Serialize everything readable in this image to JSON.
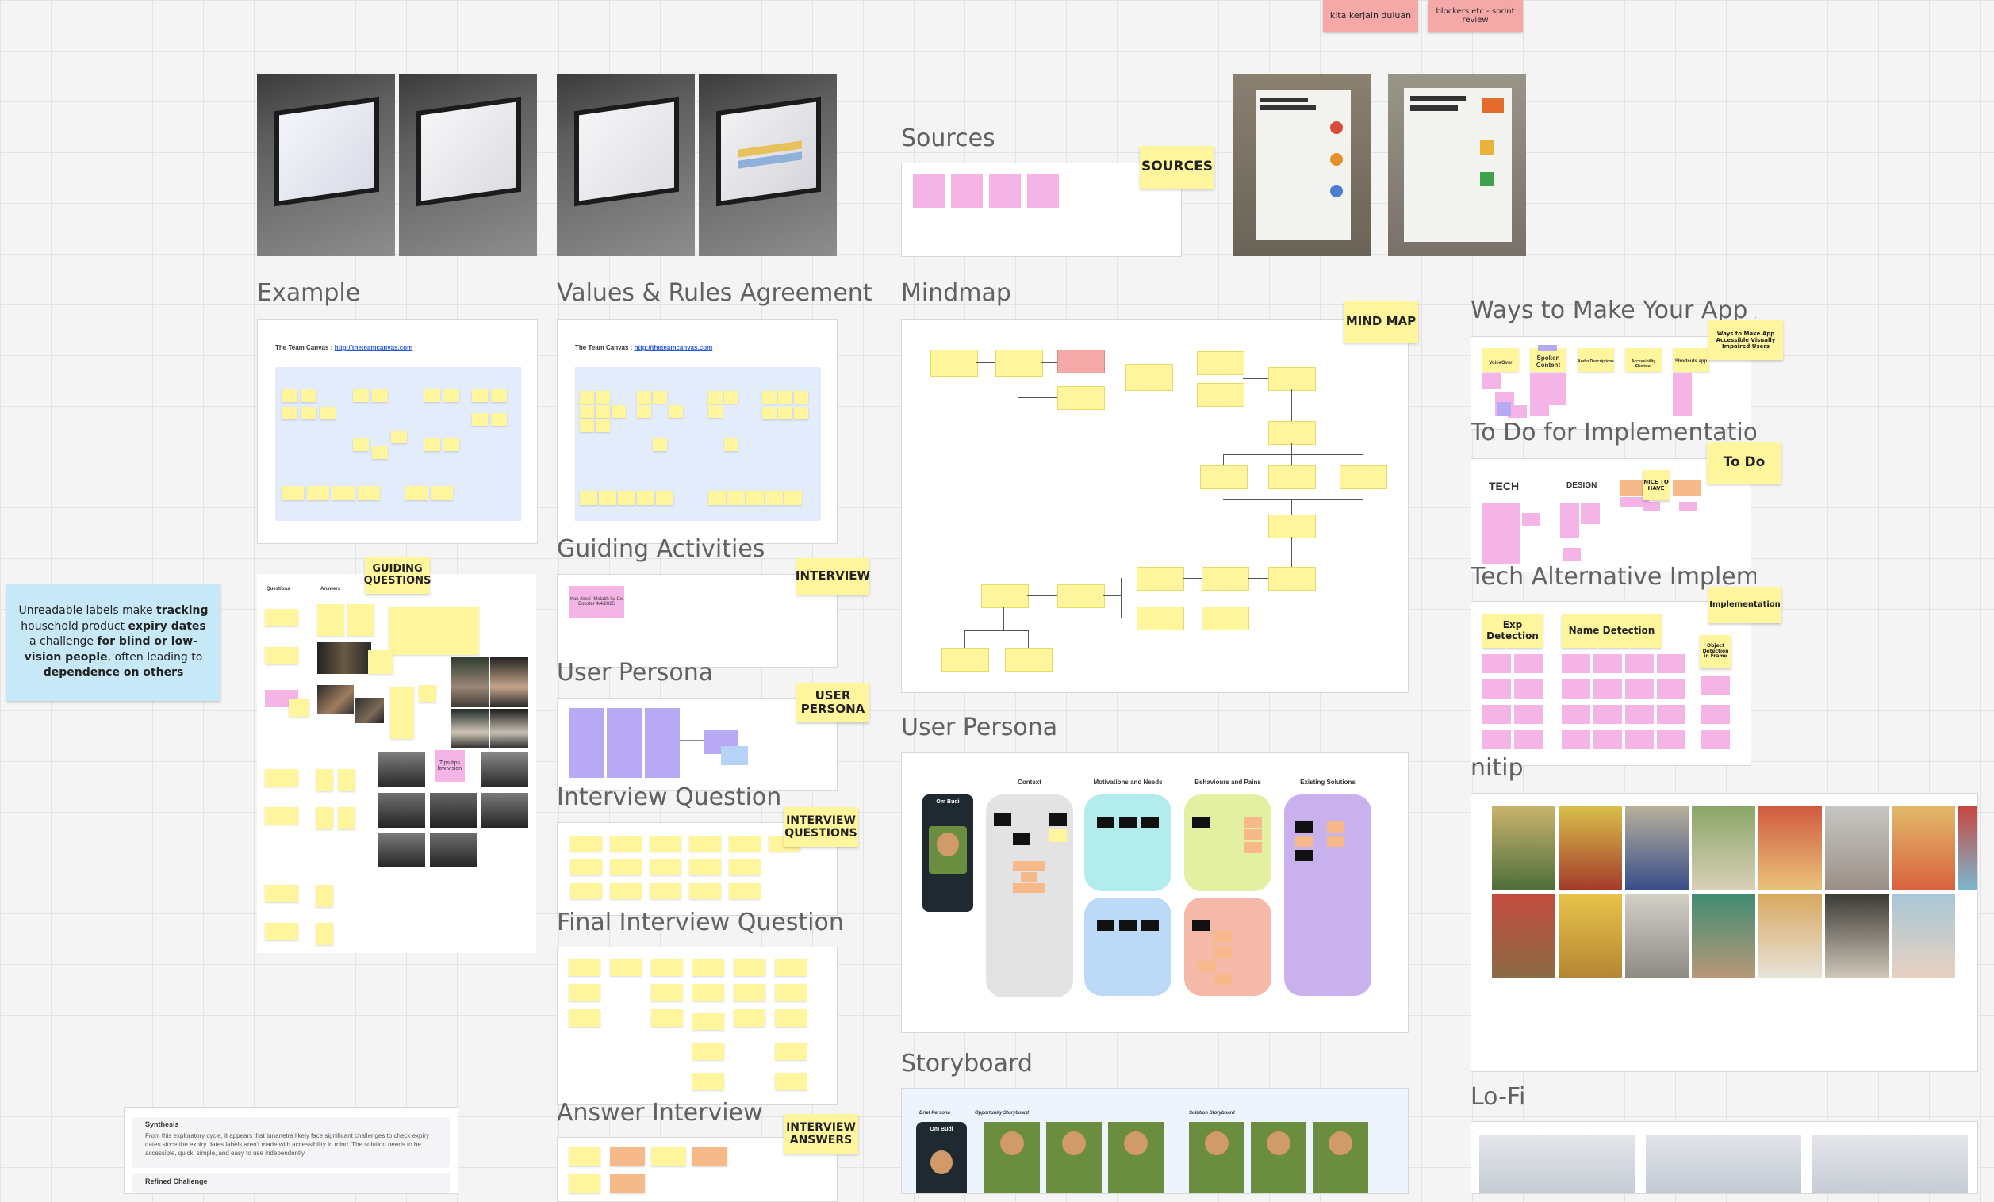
{
  "top_notes": [
    {
      "text": "kita kerjain duluan"
    },
    {
      "text": "blockers etc - sprint review"
    }
  ],
  "frames": {
    "example": "Example",
    "values": "Values & Rules Agreement",
    "guiding_activities": "Guiding Activities",
    "user_persona_small": "User Persona",
    "interview_question": "Interview Question",
    "final_interview_question": "Final Interview Question",
    "answer_interview": "Answer Interview",
    "sources": "Sources",
    "mindmap": "Mindmap",
    "user_persona": "User Persona",
    "storyboard": "Storyboard",
    "ways": "Ways to Make Your App A...",
    "todo_impl": "To Do for Implementatio...",
    "tech_alt": "Tech Alternative Impleme...",
    "nitip": "nitip",
    "lofi": "Lo-Fi"
  },
  "labels": {
    "sources": "SOURCES",
    "mind_map": "MIND MAP",
    "guiding_questions": "GUIDING QUESTIONS",
    "interview": "INTERVIEW",
    "user_persona": "USER PERSONA",
    "interview_questions": "INTERVIEW QUESTIONS",
    "interview_answers": "INTERVIEW ANSWERS",
    "to_do": "To Do",
    "implementation": "Implementation",
    "ways_note": "Ways to Make App Accessible Visually Impaired Users"
  },
  "team_canvas": {
    "title": "The Team Canvas :",
    "link": "http://theteamcanvas.com"
  },
  "problem_note": {
    "p1": "Unreadable labels make ",
    "b1": "tracking",
    "p2": " household product ",
    "b2": "expiry dates",
    "p3": " a challenge ",
    "b3": "for blind or low-vision people",
    "p4": ", often leading to ",
    "b4": "dependence on others"
  },
  "synthesis": {
    "title": "Synthesis",
    "body": "From this exploratory cycle, it appears that tunanetra likely face significant challenges to check expiry dates since the expiry dates labels aren't made with accessibility in mind. The solution needs to be accessible, quick, simple, and easy to use independently.",
    "next": "Refined Challenge"
  },
  "persona_cols": [
    "Context",
    "Motivations and Needs",
    "Behaviours and Pains",
    "Existing Solutions"
  ],
  "persona_name": "Om Budi",
  "storyboard": {
    "brief": "Brief Persona",
    "opportunity": "Opportunity Storyboard",
    "solution": "Solution Storyboard",
    "name": "Om Budi"
  },
  "ways_cols": [
    "VoiceOver",
    "Spoken Content",
    "Audio Descriptions",
    "Accessibility Shortcut",
    "Shortcuts app"
  ],
  "todo_cols": [
    "TECH",
    "DESIGN",
    "NICE TO HAVE"
  ],
  "tech_cols": [
    "Exp Detection",
    "Name Detection",
    "Object Detection in Frame"
  ],
  "guiding_sticky": "Kak Jessi -Melatih ku Co Booster 4/4/2025",
  "tips_note": "Tips-tips low vision",
  "team_canvas_cols": [
    "Questions",
    "Answers"
  ],
  "colors": {
    "yellow": "#fff59d",
    "pink": "#f4b4e6",
    "salmon": "#f5a8a8",
    "blue": "#c7e9f7",
    "purple": "#b8a9f5"
  }
}
